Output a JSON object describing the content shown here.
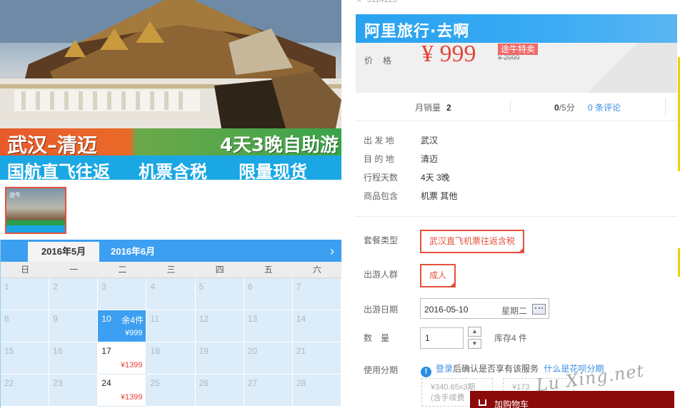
{
  "hero": {
    "route": "武汉–清迈",
    "duration": "4天3晚自助游",
    "tag_1": "国航直飞往返",
    "tag_2": "机票含税",
    "tag_3": "限量现货"
  },
  "thumb": {
    "mini_label": "途牛"
  },
  "calendar": {
    "active_month": "2016年5月",
    "next_month": "2016年6月",
    "next_arrow": "›",
    "weekdays": [
      "日",
      "一",
      "二",
      "三",
      "四",
      "五",
      "六"
    ],
    "cells": [
      {
        "d": "1"
      },
      {
        "d": "2"
      },
      {
        "d": "3"
      },
      {
        "d": "4"
      },
      {
        "d": "5"
      },
      {
        "d": "6"
      },
      {
        "d": "7"
      },
      {
        "d": "8"
      },
      {
        "d": "9"
      },
      {
        "d": "10",
        "s": "余4件",
        "p": "¥999",
        "state": "sel"
      },
      {
        "d": "11"
      },
      {
        "d": "12"
      },
      {
        "d": "13"
      },
      {
        "d": "14"
      },
      {
        "d": "15"
      },
      {
        "d": "16"
      },
      {
        "d": "17",
        "p": "¥1399",
        "state": "avail"
      },
      {
        "d": "18"
      },
      {
        "d": "19"
      },
      {
        "d": "20"
      },
      {
        "d": "21"
      },
      {
        "d": "22"
      },
      {
        "d": "23"
      },
      {
        "d": "24",
        "p": "¥1399",
        "state": "avail"
      },
      {
        "d": "25"
      },
      {
        "d": "26"
      },
      {
        "d": "27"
      },
      {
        "d": "28"
      }
    ]
  },
  "product": {
    "sku": "5114125",
    "brand_banner": "阿里旅行·去啊",
    "price_label": "价格",
    "price": "¥ 999",
    "promo_badge": "途牛特卖",
    "original_price": "¥ 2999",
    "monthly_sales_label": "月销量",
    "monthly_sales": "2",
    "rating": "0",
    "rating_scale": "/5分",
    "reviews_link": "0 条评论"
  },
  "info": [
    {
      "k": "出 发 地",
      "v": "武汉"
    },
    {
      "k": "目 的 地",
      "v": "清迈"
    },
    {
      "k": "行程天数",
      "v": "4天 3晚"
    },
    {
      "k": "商品包含",
      "v": "机票  其他"
    }
  ],
  "options": {
    "package_label": "套餐类型",
    "package_value": "武汉直飞机票往返含税",
    "crowd_label": "出游人群",
    "crowd_value": "成人",
    "date_label": "出游日期",
    "date_value": "2016-05-10",
    "date_weekday": "星期二",
    "qty_label": "数　量",
    "qty_value": "1",
    "stock": "库存4 件",
    "installment_label": "使用分期",
    "login_link": "登录",
    "login_text": "后确认是否享有该服务",
    "huabei_link": "什么是花呗分期",
    "plan_1": "¥340.65x3期",
    "plan_1_sub": "(含手续费",
    "plan_2": "¥173",
    "cart": "加购物车",
    "up_arrow": "▲",
    "down_arrow": "▼",
    "info_icon": "!"
  },
  "watermark": "Lu Xing.net"
}
